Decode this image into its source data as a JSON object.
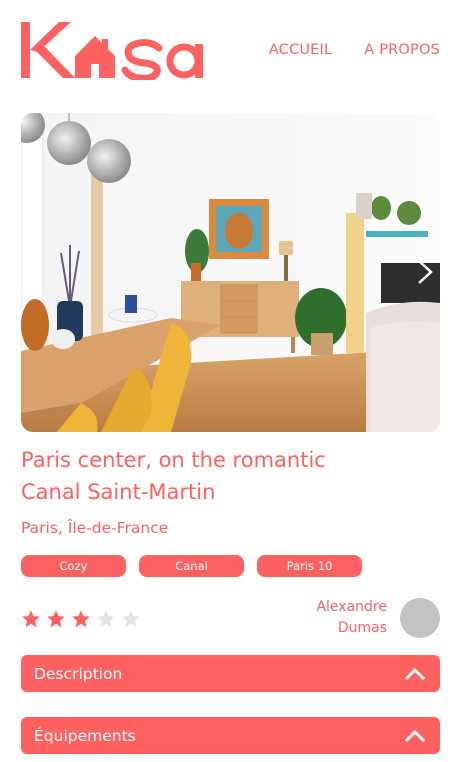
{
  "header": {
    "logo_text": "Kasa",
    "nav": [
      {
        "label": "ACCUEIL"
      },
      {
        "label": "A PROPOS"
      }
    ]
  },
  "gallery": {
    "prev_icon": "chevron-left-icon",
    "next_icon": "chevron-right-icon"
  },
  "listing": {
    "title": "Paris center, on the romantic Canal Saint-Martin",
    "location": "Paris, Île-de-France",
    "tags": [
      "Cozy",
      "Canal",
      "Paris 10"
    ],
    "rating": 3,
    "rating_max": 5,
    "host_first": "Alexandre",
    "host_last": "Dumas"
  },
  "collapses": [
    {
      "label": "Description",
      "icon": "chevron-up-icon"
    },
    {
      "label": "Équipements",
      "icon": "chevron-up-icon"
    }
  ],
  "colors": {
    "accent": "#FF6060",
    "star_empty": "#E3E3E3",
    "avatar": "#C4C4C4"
  }
}
